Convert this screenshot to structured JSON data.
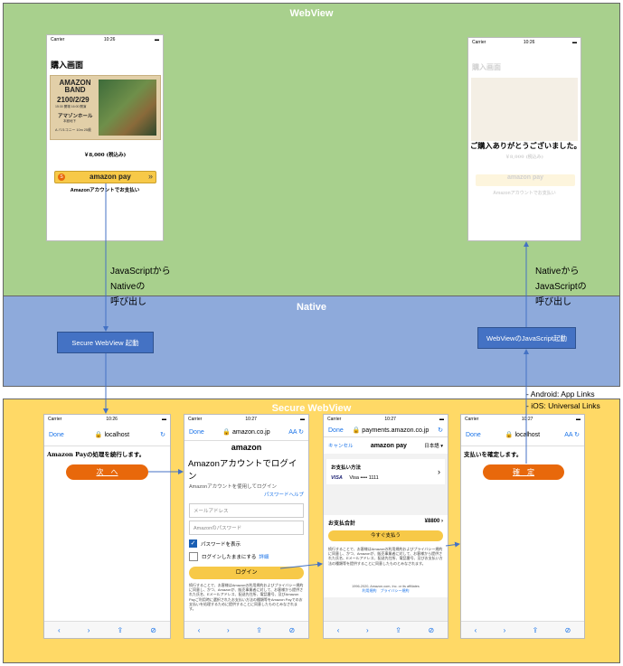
{
  "bands": {
    "webview": "WebView",
    "native": "Native",
    "secure": "Secure WebView"
  },
  "colors": {
    "webview_bg": "#a8d08d",
    "native_bg": "#8eaadb",
    "secure_bg": "#ffd966",
    "arrow": "#4472c4",
    "amazon_yellow": "#f7c948",
    "orange_button": "#e8680b"
  },
  "status": {
    "carrier": "Carrier",
    "time1": "10:26",
    "time2": "10:27"
  },
  "purchase_screen": {
    "title": "購入画面",
    "poster_band": "AMAZON BAND",
    "poster_date": "2100/2/29",
    "poster_time": "15:30 開場 16:00 開演",
    "poster_venue": "アマゾンホール",
    "poster_venue_sub": "本館地下",
    "poster_seat": "A バルコニー 10m 25歳",
    "price": "￥8,000 (税込み)",
    "pay_button": "amazon pay",
    "pay_caption": "Amazonアカウントでお支払い"
  },
  "thanks_screen": {
    "title": "購入画面",
    "message": "ご購入ありがとうございました。",
    "price": "￥8,000 (税込み)",
    "pay_button": "amazon pay",
    "pay_caption": "Amazonアカウントでお支払い"
  },
  "labels": {
    "js_to_native": [
      "JavaScriptから",
      "Nativeの",
      "呼び出し"
    ],
    "native_to_js": [
      "Nativeから",
      "JavaScriptの",
      "呼び出し"
    ],
    "links": [
      "- Android: App Links",
      "- iOS: Universal Links"
    ]
  },
  "native_buttons": {
    "secure_start": "Secure WebView 起動",
    "js_start": "WebViewのJavaScript起動"
  },
  "safari": {
    "done": "Done",
    "aa": "AA",
    "localhost": "localhost",
    "amazon_domain": "amazon.co.jp",
    "payments_domain": "payments.amazon.co.jp"
  },
  "screen_s1": {
    "text": "Amazon Payの処理を続行します。",
    "button": "次　へ"
  },
  "screen_s2": {
    "logo": "amazon",
    "title": "Amazonアカウントでログイン",
    "subtitle": "Amazonアカウントを使用してログイン",
    "help": "パスワードヘルプ",
    "email_placeholder": "メールアドレス",
    "password_placeholder": "Amazonのパスワード",
    "show_password": "パスワードを表示",
    "keep_login": "ログインしたままにする",
    "detail": "詳細",
    "login_button": "ログイン",
    "terms": "続行することで、お客様はAmazonの利用規約およびプライバシー規約に同意し、かつ、Amazonが、販売事業者に対して、お客様から提供された氏名、Eメールアドレス、配送先住所、電話番号、及びAmazon Payご利用時に選択されたお支払い方法の種類等をAmazon Payでのお支払いを処理するために提供することに同意したものとみなされます。"
  },
  "screen_s3": {
    "cancel": "キャンセル",
    "logo": "amazon pay",
    "lang": "日本語",
    "method_label": "お支払い方法",
    "card_brand": "VISA",
    "card_number": "Visa •••• 1111",
    "total_label": "お支払合計",
    "total_value": "¥8800",
    "pay_now": "今すぐ支払う",
    "terms": "続行することで、お客様はAmazonの利用規約およびプライバシー規約に同意し、かつ、Amazonが、販売事業者に対して、お客様から提供された氏名、Eメールアドレス、配送先住所、電話番号、及びお支払い方法の種類等を提供することに同意したものとみなされます。",
    "copyright": "1996-2020, Amazon.com, Inc. or its affiliates",
    "footer_links": "利用規約　プライバシー規約"
  },
  "screen_s4": {
    "text": "支払いを確定します。",
    "button": "確　定"
  }
}
